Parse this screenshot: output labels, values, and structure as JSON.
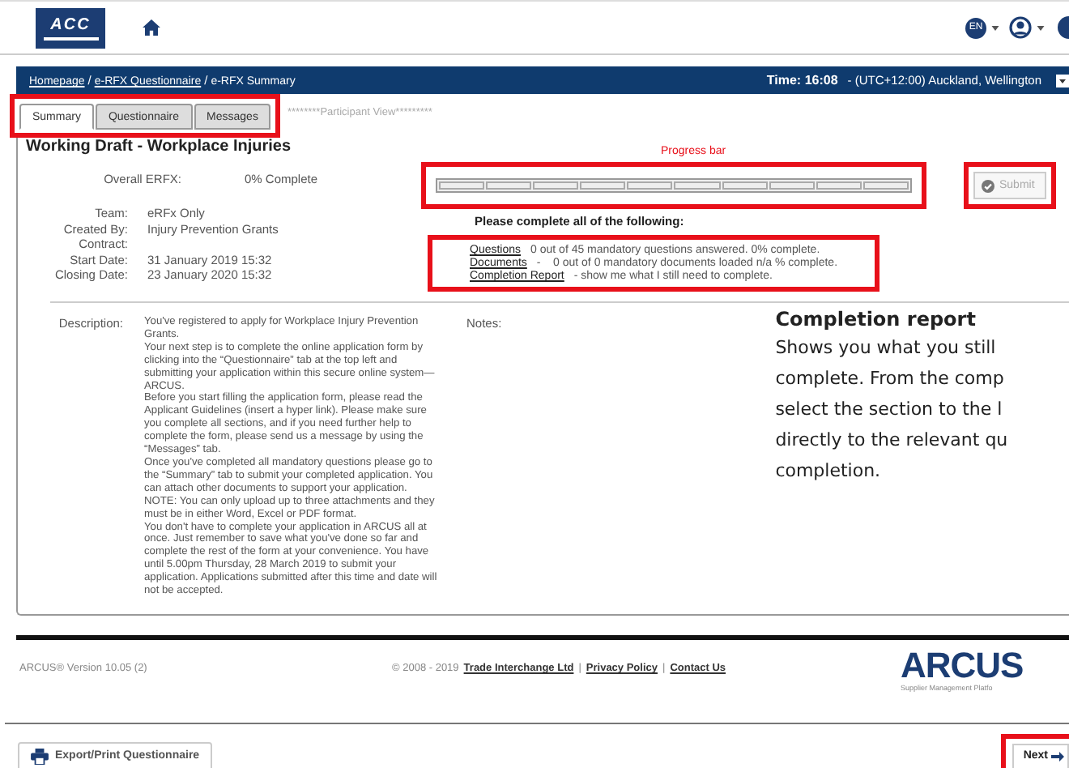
{
  "header": {
    "logo_text": "ACC",
    "language": "EN"
  },
  "breadcrumb_separator": "/",
  "breadcrumb": [
    {
      "label": "Homepage",
      "link": true
    },
    {
      "label": "e-RFX Questionnaire",
      "link": true
    },
    {
      "label": "e-RFX Summary",
      "link": false
    }
  ],
  "time": {
    "label": "Time: 16:08",
    "zone": "- (UTC+12:00) Auckland, Wellington"
  },
  "tabs": {
    "highlighted": true,
    "items": [
      {
        "label": "Summary",
        "selected": true
      },
      {
        "label": "Questionnaire",
        "selected": false
      },
      {
        "label": "Messages",
        "selected": false
      }
    ],
    "view_label": "********Participant View*********"
  },
  "title": "Working Draft - Workplace Injuries",
  "overall": {
    "label": "Overall ERFX:",
    "value": "0% Complete"
  },
  "details": [
    {
      "label": "Team:",
      "value": "eRFx Only"
    },
    {
      "label": "Created By:",
      "value": "Injury Prevention Grants"
    },
    {
      "label": "Contract:"
    },
    {
      "label": "Start Date:",
      "value": "31 January 2019 15:32"
    },
    {
      "label": "Closing Date:",
      "value": "23 January 2020 15:32"
    }
  ],
  "progress": {
    "annotation": "Progress bar",
    "highlighted": true
  },
  "submit": {
    "label": "Submit",
    "disabled": true,
    "highlighted": true
  },
  "requirements": {
    "heading": "Please complete all of the following:",
    "highlighted": true,
    "items": [
      {
        "link": "Questions",
        "text": "0 out of 45 mandatory questions answered. 0% complete."
      },
      {
        "link": "Documents",
        "text": "-    0 out of 0 mandatory documents loaded n/a % complete."
      },
      {
        "link": "Completion Report",
        "text": "- show me what I still need to complete."
      }
    ]
  },
  "description": {
    "label": "Description:",
    "paragraphs": [
      "You've registered to apply for Workplace Injury Prevention Grants.",
      "Your next step is to complete the online application form by clicking into the “Questionnaire” tab at the top left and submitting your application within this secure online system—ARCUS.",
      "Before you start filling the application form, please read the Applicant Guidelines (insert a hyper link). Please make sure you complete all sections, and if you need further help to complete the form, please send us a message by using the “Messages” tab.",
      "Once you've completed all mandatory questions please go to the “Summary” tab to submit your completed application. You can attach other documents to support your application. NOTE: You can only upload up to three attachments and they must be in either Word, Excel or PDF format.",
      "You don't have to complete your application in ARCUS all at once. Just remember to save what you've done so far and complete the rest of the form at your convenience. You have until 5.00pm Thursday, 28 March 2019 to submit your application. Applications submitted after this time and date will not be accepted."
    ]
  },
  "notes": {
    "label": "Notes:"
  },
  "callout": {
    "heading": "Completion report",
    "lines": [
      "Shows you what you still",
      "complete. From the comp",
      "select the section to the l",
      "directly to the relevant qu",
      "completion."
    ]
  },
  "footer": {
    "version": "ARCUS® Version 10.05 (2)",
    "copyright": "© 2008 - 2019",
    "separator": "|",
    "links": [
      "Trade Interchange Ltd",
      "Privacy Policy",
      "Contact Us"
    ],
    "brand": "ARCUS",
    "brand_sub": "Supplier Management Platfo"
  },
  "actions": {
    "export": "Export/Print Questionnaire",
    "next": {
      "label": "Next",
      "highlighted": true
    }
  }
}
